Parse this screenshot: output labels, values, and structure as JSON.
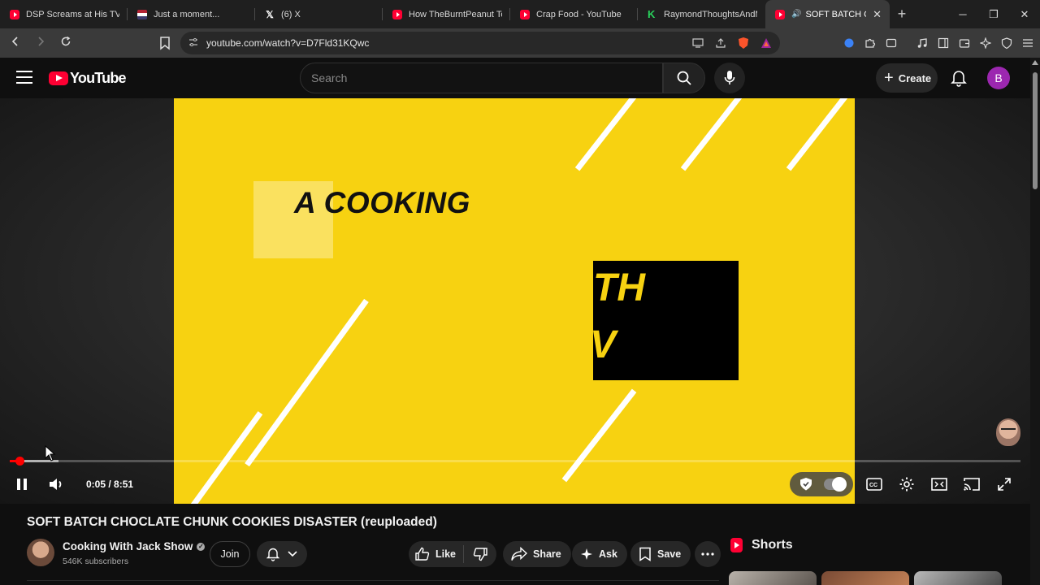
{
  "browser": {
    "tabs": [
      {
        "label": "DSP Screams at His TV as",
        "icon": "youtube-icon"
      },
      {
        "label": "Just a moment...",
        "icon": "flag-icon"
      },
      {
        "label": "(6) X",
        "icon": "x-icon"
      },
      {
        "label": "How TheBurntPeanut Took",
        "icon": "youtube-icon"
      },
      {
        "label": "Crap Food - YouTube",
        "icon": "youtube-icon"
      },
      {
        "label": "RaymondThoughtsAndMi",
        "icon": "kick-icon"
      },
      {
        "label": "SOFT BATCH CHOC",
        "icon": "youtube-icon",
        "active": true
      }
    ],
    "url": "youtube.com/watch?v=D7Fld31KQwc"
  },
  "header": {
    "logo_text": "YouTube",
    "search_placeholder": "Search",
    "create_label": "Create",
    "avatar_letter": "B",
    "accent": "#ff0033",
    "avatar_color": "#9c27b0"
  },
  "player": {
    "video_text_top": "A COOKING",
    "video_text_box_1": "TH",
    "video_text_box_2": "V",
    "time": "0:05 / 8:51",
    "progress_fraction": 0.0098,
    "video_bg": "#f7d211"
  },
  "video": {
    "title": "SOFT BATCH CHOCLATE CHUNK COOKIES DISASTER (reuploaded)",
    "channel": "Cooking With Jack Show",
    "subscribers": "546K subscribers",
    "join_label": "Join",
    "like_label": "Like",
    "share_label": "Share",
    "ask_label": "Ask",
    "save_label": "Save"
  },
  "sidebar": {
    "shorts_label": "Shorts"
  }
}
